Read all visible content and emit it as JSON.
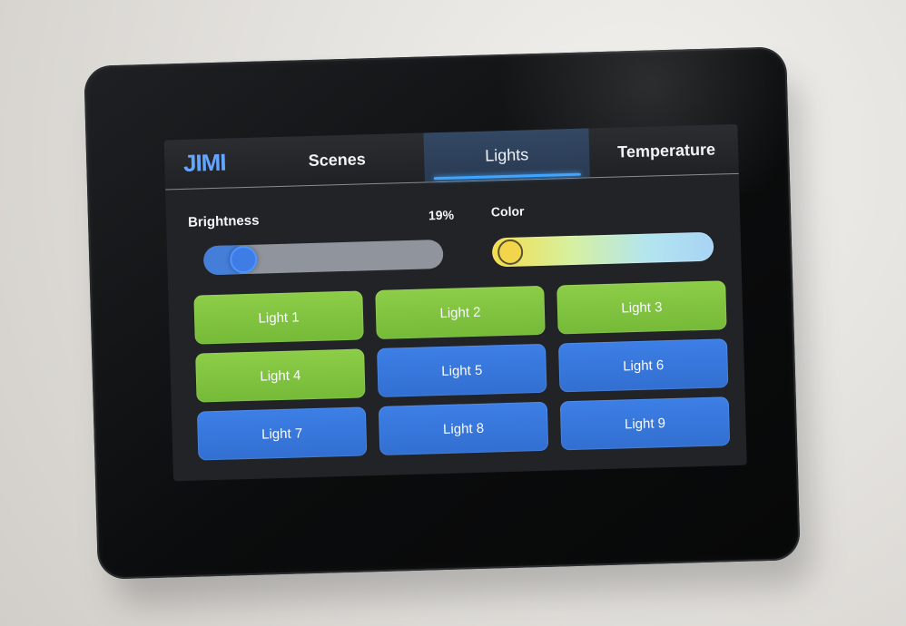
{
  "app": {
    "logo_text": "JIMI"
  },
  "tabs": {
    "scenes": "Scenes",
    "lights": "Lights",
    "temperature": "Temperature",
    "active": "Lights"
  },
  "controls": {
    "brightness": {
      "label": "Brightness",
      "value_text": "19%",
      "percent": 19
    },
    "color": {
      "label": "Color",
      "value": 0.02
    }
  },
  "lights": [
    {
      "label": "Light 1",
      "status": "on",
      "color": "#7bc13f"
    },
    {
      "label": "Light 2",
      "status": "on",
      "color": "#7bc13f"
    },
    {
      "label": "Light 3",
      "status": "on",
      "color": "#7bc13f"
    },
    {
      "label": "Light 4",
      "status": "on",
      "color": "#7bc13f"
    },
    {
      "label": "Light 5",
      "status": "off",
      "color": "#3d7fe6"
    },
    {
      "label": "Light 6",
      "status": "off",
      "color": "#3d7fe6"
    },
    {
      "label": "Light 7",
      "status": "off",
      "color": "#3d7fe6"
    },
    {
      "label": "Light 8",
      "status": "off",
      "color": "#3d7fe6"
    },
    {
      "label": "Light 9",
      "status": "off",
      "color": "#3d7fe6"
    }
  ],
  "theme": {
    "active_tab_color": "#40a5ff",
    "screen_bg": "#212327",
    "on_color": "#7bc13f",
    "off_color": "#3d7fe6",
    "logo_color": "#64a6ff"
  }
}
